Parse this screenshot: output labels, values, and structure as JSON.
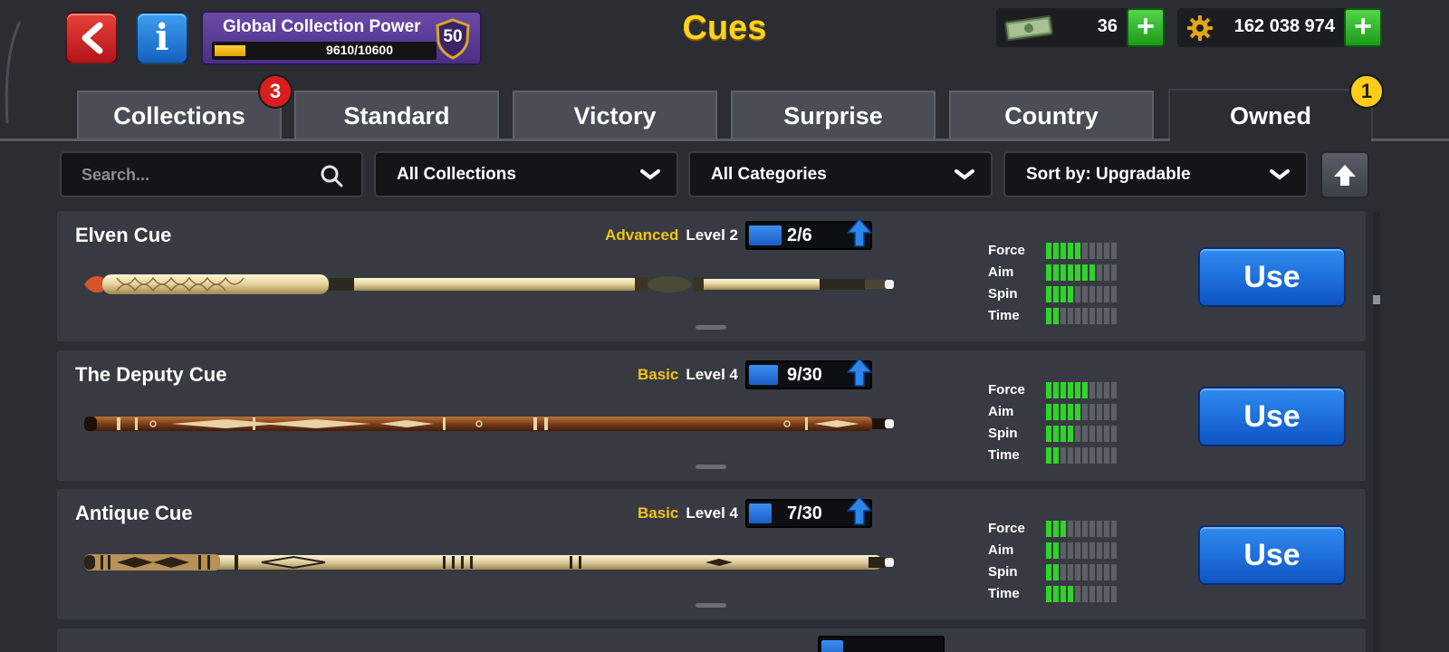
{
  "header": {
    "title": "Cues",
    "collection_power": {
      "label": "Global Collection Power",
      "progress_text": "9610/10600",
      "progress_fraction": 0.14,
      "level": "50"
    },
    "cash": {
      "amount": "36",
      "icon": "cash-icon"
    },
    "coins": {
      "amount": "162 038 974",
      "icon": "coin-gear-icon"
    }
  },
  "tabs": [
    {
      "label": "Collections",
      "badge": "3"
    },
    {
      "label": "Standard"
    },
    {
      "label": "Victory"
    },
    {
      "label": "Surprise"
    },
    {
      "label": "Country"
    },
    {
      "label": "Owned",
      "badge": "1",
      "active": true
    }
  ],
  "filters": {
    "search_placeholder": "Search...",
    "collection": "All Collections",
    "category": "All Categories",
    "sort": "Sort by: Upgradable"
  },
  "stat_labels": [
    "Force",
    "Aim",
    "Spin",
    "Time"
  ],
  "cues": [
    {
      "name": "Elven Cue",
      "tier": "Advanced",
      "level": "Level 2",
      "progress": "2/6",
      "progress_fraction": 0.333,
      "stats": {
        "force": 5,
        "aim": 7,
        "spin": 4,
        "time": 2
      },
      "button": "Use"
    },
    {
      "name": "The Deputy Cue",
      "tier": "Basic",
      "level": "Level 4",
      "progress": "9/30",
      "progress_fraction": 0.3,
      "stats": {
        "force": 6,
        "aim": 5,
        "spin": 4,
        "time": 2
      },
      "button": "Use"
    },
    {
      "name": "Antique Cue",
      "tier": "Basic",
      "level": "Level 4",
      "progress": "7/30",
      "progress_fraction": 0.233,
      "stats": {
        "force": 3,
        "aim": 2,
        "spin": 2,
        "time": 4
      },
      "button": "Use"
    }
  ],
  "colors": {
    "accent_title": "#ffd21f",
    "tier": "#f2c21a",
    "stat_on": "#2fd42a",
    "use_button": "#1a6fe0"
  }
}
